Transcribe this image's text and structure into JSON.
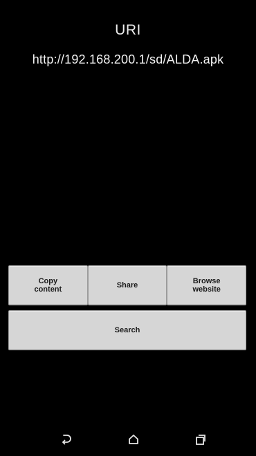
{
  "screen": {
    "title": "URI",
    "uri": "http://192.168.200.1/sd/ALDA.apk"
  },
  "actions": {
    "copy_label": "Copy\ncontent",
    "share_label": "Share",
    "browse_label": "Browse\nwebsite",
    "search_label": "Search"
  },
  "navbar": {
    "back_icon": "back-icon",
    "home_icon": "home-icon",
    "recents_icon": "recents-icon"
  },
  "colors": {
    "background": "#000000",
    "button_bg": "#d6d6d6",
    "text": "#ffffff"
  }
}
